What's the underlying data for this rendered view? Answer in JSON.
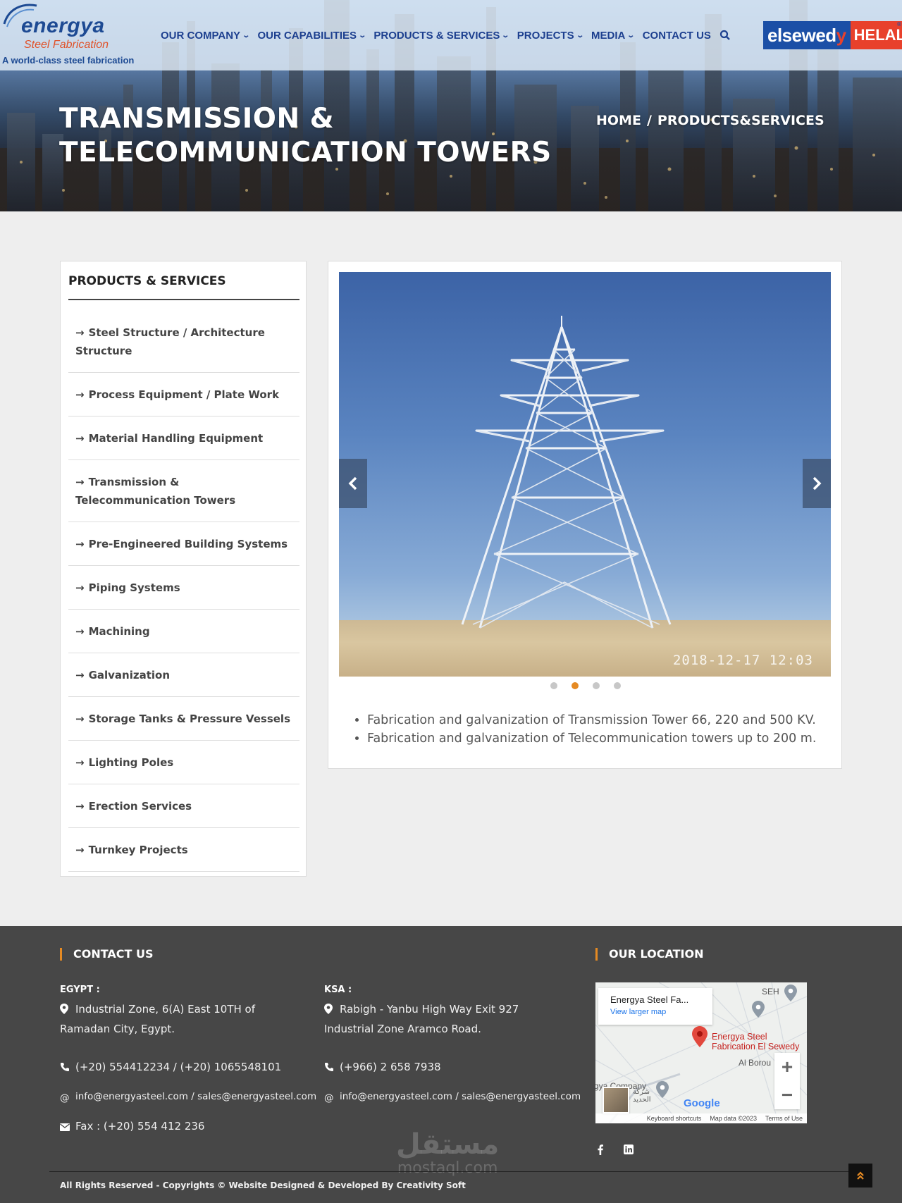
{
  "header": {
    "logo": {
      "word": "energya",
      "sub": "Steel Fabrication",
      "tagline": "A world-class steel fabrication"
    },
    "nav": [
      {
        "label": "OUR COMPANY",
        "dropdown": true
      },
      {
        "label": "OUR CAPABILITIES",
        "dropdown": true
      },
      {
        "label": "PRODUCTS & SERVICES",
        "dropdown": true
      },
      {
        "label": "PROJECTS",
        "dropdown": true
      },
      {
        "label": "MEDIA",
        "dropdown": true
      },
      {
        "label": "CONTACT US",
        "dropdown": false
      }
    ],
    "brand": {
      "part1": "elsewed",
      "part1_y": "y",
      "part2": "HELAL",
      "reg": "®"
    }
  },
  "hero": {
    "title_line1": "TRANSMISSION &",
    "title_line2": "TELECOMMUNICATION TOWERS",
    "breadcrumb_home": "HOME",
    "breadcrumb_sep": "/",
    "breadcrumb_current": "PRODUCTS&SERVICES"
  },
  "sidebar": {
    "title": "PRODUCTS & SERVICES",
    "items": [
      "Steel Structure / Architecture Structure",
      "Process Equipment / Plate Work",
      "Material Handling Equipment",
      "Transmission & Telecommunication Towers",
      "Pre-Engineered Building Systems",
      "Piping Systems",
      "Machining",
      "Galvanization",
      "Storage Tanks & Pressure Vessels",
      "Lighting Poles",
      "Erection Services",
      "Turnkey Projects"
    ]
  },
  "carousel": {
    "timestamp": "2018-12-17 12:03",
    "dots": 4,
    "active_dot": 2
  },
  "description": [
    "Fabrication and galvanization of Transmission Tower 66, 220 and 500 KV.",
    "Fabrication and galvanization of Telecommunication towers up to 200 m."
  ],
  "footer": {
    "contact_heading": "CONTACT US",
    "location_heading": "OUR LOCATION",
    "egypt": {
      "label": "EGYPT :",
      "address": "Industrial Zone, 6(A) East 10TH of Ramadan City, Egypt.",
      "phone": "(+20) 554412234 / (+20) 1065548101",
      "email": "info@energyasteel.com / sales@energyasteel.com",
      "fax": "Fax : (+20) 554 412 236"
    },
    "ksa": {
      "label": "KSA :",
      "address": "Rabigh - Yanbu High Way Exit 927 Industrial Zone Aramco Road.",
      "phone": "(+966) 2 658 7938",
      "email": "info@energyasteel.com / sales@energyasteel.com"
    },
    "map": {
      "card_title": "Energya Steel Fa...",
      "card_link": "View larger map",
      "pin_label_1": "Energya Steel",
      "pin_label_2": "Fabrication El Sewedy",
      "label_seh": "SEH",
      "label_alboro": "Al Borou",
      "label_company": "gya Company",
      "label_arabic_1": "شركة",
      "label_arabic_2": "الحديد",
      "google": "Google",
      "shortcuts": "Keyboard shortcuts",
      "mapdata": "Map data ©2023",
      "terms": "Terms of Use",
      "zoom_in": "+",
      "zoom_out": "−"
    },
    "watermark_ar": "مستقل",
    "watermark_en": "mostaql.com",
    "copyright": "All Rights Reserved - Copyrights © Website Designed & Developed By Creativity Soft"
  },
  "colors": {
    "nav": "#1c3f8f",
    "accent": "#e58a23",
    "footer": "#474747"
  }
}
